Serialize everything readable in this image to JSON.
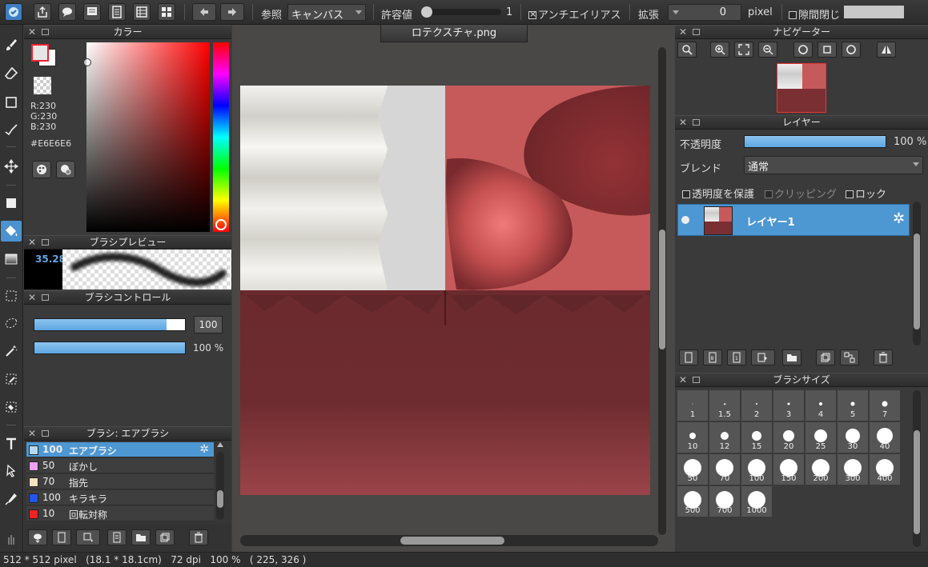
{
  "toolbar": {
    "ref_label": "参照",
    "ref_value": "キャンバス",
    "tolerance_label": "許容値",
    "tolerance_value": "1",
    "antialias_label": "アンチエイリアス",
    "expand_label": "拡張",
    "expand_value": "0",
    "expand_unit": "pixel",
    "gap_close_label": "隙間閉じ"
  },
  "color_panel": {
    "title": "カラー",
    "r": "R:230",
    "g": "G:230",
    "b": "B:230",
    "hex": "#E6E6E6",
    "foreground": "#E6E6E6",
    "background": "#FFFFFF"
  },
  "brush_preview": {
    "title": "ブラシプレビュー",
    "size": "35.28"
  },
  "brush_control": {
    "title": "ブラシコントロール",
    "size_value": "100",
    "size_fill": 0.88,
    "opacity_value": "100 %",
    "opacity_fill": 1.0
  },
  "brush_list": {
    "title": "ブラシ: エアブラシ",
    "items": [
      {
        "size": "100",
        "name": "エアブラシ",
        "color": "#b8d8f0",
        "selected": true
      },
      {
        "size": "50",
        "name": "ぼかし",
        "color": "#f0a0f0"
      },
      {
        "size": "70",
        "name": "指先",
        "color": "#f5e0c0"
      },
      {
        "size": "100",
        "name": "キラキラ",
        "color": "#2255ee"
      },
      {
        "size": "10",
        "name": "回転対称",
        "color": "#ee2222"
      }
    ]
  },
  "document": {
    "tab_title": "ロテクスチャ.png"
  },
  "navigator": {
    "title": "ナビゲーター"
  },
  "layer_panel": {
    "title": "レイヤー",
    "opacity_label": "不透明度",
    "opacity_value": "100 %",
    "opacity_fill": 1.0,
    "blend_label": "ブレンド",
    "blend_value": "通常",
    "protect_alpha": "透明度を保護",
    "clipping": "クリッピング",
    "lock": "ロック",
    "layers": [
      {
        "name": "レイヤー1",
        "selected": true
      }
    ]
  },
  "brush_size": {
    "title": "ブラシサイズ",
    "sizes": [
      "1",
      "1.5",
      "2",
      "3",
      "4",
      "5",
      "7",
      "10",
      "12",
      "15",
      "20",
      "25",
      "30",
      "40",
      "50",
      "70",
      "100",
      "150",
      "200",
      "300",
      "400",
      "500",
      "700",
      "1000"
    ]
  },
  "status": {
    "text": "512 * 512 pixel   (18.1 * 18.1cm)   72 dpi   100 %   ( 225, 326 )"
  }
}
